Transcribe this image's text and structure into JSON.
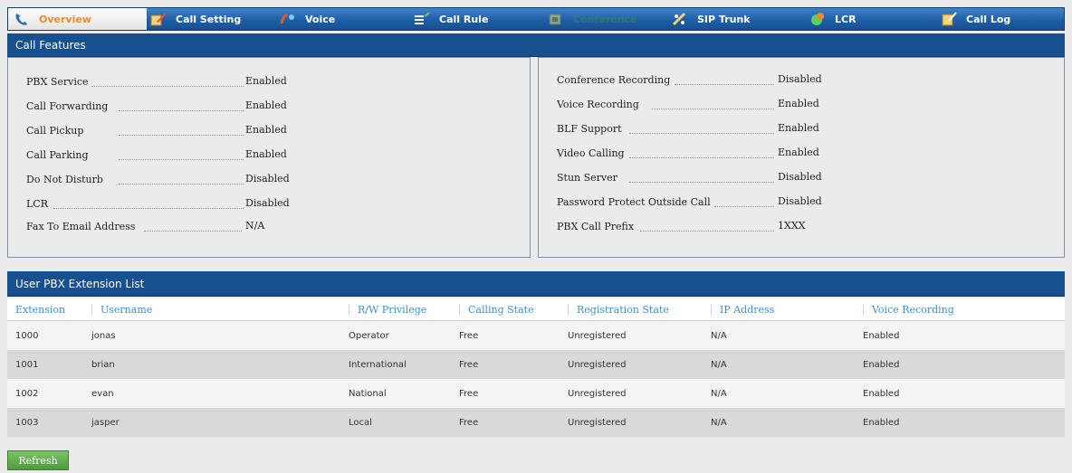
{
  "tabs": [
    {
      "label": "Overview",
      "icon": "phone-icon",
      "active": true
    },
    {
      "label": "Call Setting",
      "icon": "pencil-icon"
    },
    {
      "label": "Voice",
      "icon": "voice-icon"
    },
    {
      "label": "Call Rule",
      "icon": "list-icon"
    },
    {
      "label": "Conference",
      "icon": "conference-icon"
    },
    {
      "label": "SIP Trunk",
      "icon": "sip-trunk-icon"
    },
    {
      "label": "LCR",
      "icon": "lcr-icon"
    },
    {
      "label": "Call Log",
      "icon": "call-log-icon"
    }
  ],
  "call_features": {
    "title": "Call Features",
    "left": [
      {
        "label": "PBX Service",
        "value": "Enabled"
      },
      {
        "label": "Call Forwarding",
        "value": "Enabled"
      },
      {
        "label": "Call Pickup",
        "value": "Enabled"
      },
      {
        "label": "Call Parking",
        "value": "Enabled"
      },
      {
        "label": "Do Not Disturb",
        "value": "Disabled"
      },
      {
        "label": "LCR",
        "value": "Disabled"
      },
      {
        "label": "Fax To Email Address",
        "value": "N/A"
      }
    ],
    "right": [
      {
        "label": "Conference Recording",
        "value": "Disabled"
      },
      {
        "label": "Voice Recording",
        "value": "Enabled"
      },
      {
        "label": "BLF Support",
        "value": "Enabled"
      },
      {
        "label": "Video Calling",
        "value": "Enabled"
      },
      {
        "label": "Stun Server",
        "value": "Disabled"
      },
      {
        "label": "Password Protect Outside Call",
        "value": "Disabled"
      },
      {
        "label": "PBX Call Prefix",
        "value": "1XXX"
      }
    ]
  },
  "extension_list": {
    "title": "User PBX Extension List",
    "columns": [
      "Extension",
      "Username",
      "R/W Privilege",
      "Calling State",
      "Registration State",
      "IP Address",
      "Voice Recording"
    ],
    "rows": [
      [
        "1000",
        "jonas",
        "Operator",
        "Free",
        "Unregistered",
        "N/A",
        "Enabled"
      ],
      [
        "1001",
        "brian",
        "International",
        "Free",
        "Unregistered",
        "N/A",
        "Enabled"
      ],
      [
        "1002",
        "evan",
        "National",
        "Free",
        "Unregistered",
        "N/A",
        "Enabled"
      ],
      [
        "1003",
        "jasper",
        "Local",
        "Free",
        "Unregistered",
        "N/A",
        "Enabled"
      ]
    ]
  },
  "refresh_label": "Refresh",
  "colors": {
    "header_bg": "#17508f",
    "accent_orange": "#f08a24",
    "column_header_text": "#3d8fd1",
    "refresh_green": "#5aa848"
  }
}
